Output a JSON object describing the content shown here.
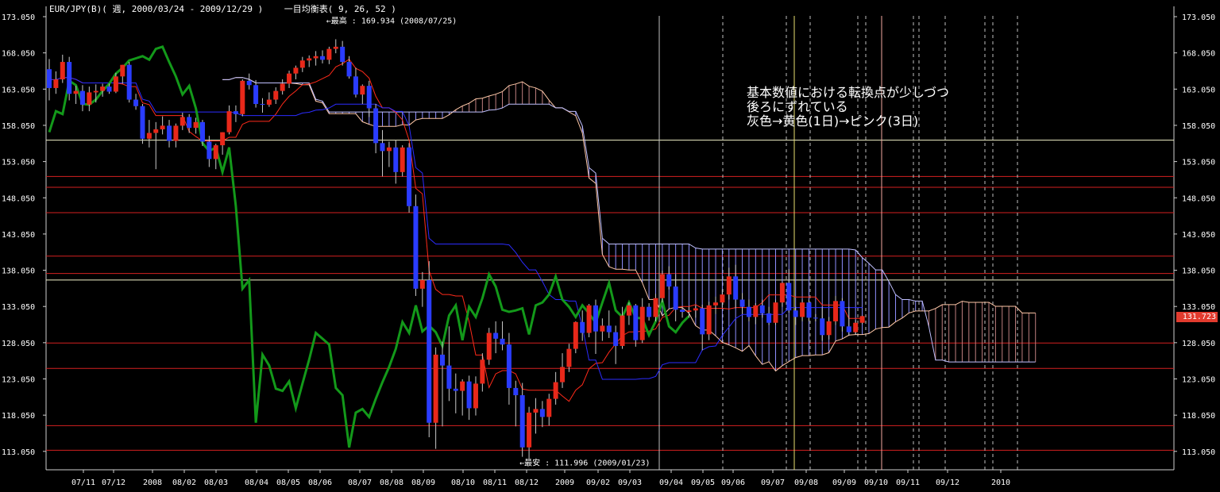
{
  "header": {
    "symbol": "EUR/JPY(B)( 週, 2000/03/24 - 2009/12/29 )",
    "indicator": "一目均衡表( 9, 26, 52 )"
  },
  "annotation": {
    "line1": "基本数値における転換点が少しづつ",
    "line2": "後ろにずれている",
    "line3": "灰色→黄色(1日)→ピンク(3日)"
  },
  "last_price": "131.723",
  "chart_data": {
    "type": "candlestick",
    "title": "",
    "ylim": [
      110.5,
      175.5
    ],
    "y_ticks": [
      "173.050",
      "168.050",
      "163.050",
      "158.050",
      "153.050",
      "148.050",
      "143.050",
      "138.050",
      "133.050",
      "128.050",
      "123.050",
      "118.050",
      "113.050"
    ],
    "x_ticks": [
      "07/11",
      "07/12",
      "2008",
      "08/02",
      "08/03",
      "08/04",
      "08/05",
      "08/06",
      "08/07",
      "08/08",
      "08/09",
      "08/10",
      "08/11",
      "08/12",
      "2009",
      "09/02",
      "09/03",
      "09/04",
      "09/05",
      "09/06",
      "09/07",
      "09/08",
      "09/09",
      "09/10",
      "09/11",
      "09/12",
      "2010"
    ],
    "highest_label": "←最高 : 169.934 (2008/07/25)",
    "lowest_label": "←最安 : 111.996 (2009/01/23)",
    "horizontal_lines": [
      156.0,
      151.0,
      149.5,
      146.0,
      140.0,
      137.6,
      136.7,
      128.0,
      124.5,
      116.6,
      113.2
    ],
    "candles": [
      [
        165.8,
        167.2,
        161.5,
        163.2
      ],
      [
        163.2,
        165.5,
        162.4,
        164.4
      ],
      [
        164.4,
        167.8,
        163.9,
        166.8
      ],
      [
        166.8,
        167.5,
        161.5,
        162.4
      ],
      [
        162.4,
        163.5,
        161.0,
        162.8
      ],
      [
        162.8,
        163.6,
        160.0,
        160.9
      ],
      [
        160.9,
        163.4,
        160.0,
        162.6
      ],
      [
        162.6,
        163.7,
        161.2,
        162.8
      ],
      [
        162.8,
        163.8,
        162.0,
        163.4
      ],
      [
        163.4,
        163.8,
        162.4,
        162.7
      ],
      [
        162.7,
        165.3,
        162.5,
        164.8
      ],
      [
        164.8,
        166.4,
        163.8,
        166.4
      ],
      [
        166.4,
        166.8,
        161.2,
        161.6
      ],
      [
        161.6,
        162.4,
        160.2,
        160.7
      ],
      [
        160.7,
        161.0,
        155.5,
        156.2
      ],
      [
        156.2,
        158.8,
        155.0,
        157.0
      ],
      [
        157.0,
        158.5,
        152.0,
        157.5
      ],
      [
        157.5,
        159.3,
        156.8,
        158.0
      ],
      [
        158.0,
        158.8,
        155.0,
        155.9
      ],
      [
        155.9,
        158.3,
        155.0,
        158.0
      ],
      [
        158.0,
        159.8,
        157.4,
        159.2
      ],
      [
        159.2,
        159.6,
        157.0,
        157.7
      ],
      [
        157.7,
        159.1,
        156.9,
        158.5
      ],
      [
        158.5,
        158.8,
        155.2,
        155.8
      ],
      [
        155.8,
        156.6,
        152.3,
        153.4
      ],
      [
        153.4,
        155.5,
        152.0,
        155.3
      ],
      [
        155.3,
        157.1,
        154.0,
        157.1
      ],
      [
        157.1,
        160.8,
        156.8,
        160.0
      ],
      [
        160.0,
        160.8,
        158.5,
        159.6
      ],
      [
        159.6,
        164.4,
        159.3,
        164.2
      ],
      [
        164.2,
        165.2,
        163.0,
        163.6
      ],
      [
        163.6,
        164.3,
        160.5,
        161.0
      ],
      [
        161.0,
        161.8,
        159.8,
        160.9
      ],
      [
        160.9,
        162.6,
        160.6,
        161.6
      ],
      [
        161.6,
        163.3,
        161.0,
        162.8
      ],
      [
        162.8,
        164.4,
        162.3,
        163.8
      ],
      [
        163.8,
        165.6,
        163.2,
        165.2
      ],
      [
        165.2,
        166.3,
        164.4,
        166.0
      ],
      [
        166.0,
        167.5,
        165.4,
        167.0
      ],
      [
        167.0,
        167.7,
        166.1,
        167.3
      ],
      [
        167.3,
        168.3,
        166.3,
        167.6
      ],
      [
        167.6,
        168.4,
        166.6,
        167.1
      ],
      [
        167.1,
        168.9,
        166.5,
        168.6
      ],
      [
        168.6,
        169.934,
        168.0,
        168.9
      ],
      [
        168.9,
        169.7,
        166.3,
        166.8
      ],
      [
        166.8,
        167.6,
        164.5,
        164.8
      ],
      [
        164.8,
        166.0,
        161.9,
        162.3
      ],
      [
        162.3,
        163.7,
        161.0,
        163.5
      ],
      [
        163.5,
        164.2,
        159.2,
        160.4
      ],
      [
        160.4,
        161.0,
        154.2,
        155.6
      ],
      [
        155.6,
        157.4,
        151.0,
        154.5
      ],
      [
        154.5,
        155.8,
        152.3,
        155.0
      ],
      [
        155.0,
        156.0,
        150.0,
        151.6
      ],
      [
        151.6,
        155.3,
        151.0,
        155.0
      ],
      [
        155.0,
        155.6,
        146.0,
        146.9
      ],
      [
        146.9,
        148.5,
        134.5,
        135.5
      ],
      [
        135.5,
        137.8,
        133.0,
        136.7
      ],
      [
        136.7,
        139.3,
        115.0,
        117.0
      ],
      [
        117.0,
        127.4,
        113.4,
        126.4
      ],
      [
        126.4,
        128.2,
        116.5,
        124.9
      ],
      [
        124.9,
        130.3,
        120.0,
        121.7
      ],
      [
        121.7,
        123.8,
        118.3,
        121.4
      ],
      [
        121.4,
        123.0,
        118.0,
        122.7
      ],
      [
        122.7,
        123.5,
        117.4,
        119.0
      ],
      [
        119.0,
        123.4,
        118.0,
        122.4
      ],
      [
        122.4,
        126.6,
        121.3,
        125.7
      ],
      [
        125.7,
        130.1,
        125.0,
        129.4
      ],
      [
        129.4,
        131.0,
        126.6,
        128.6
      ],
      [
        128.6,
        131.0,
        127.0,
        127.8
      ],
      [
        127.8,
        129.4,
        119.5,
        121.8
      ],
      [
        121.8,
        122.8,
        116.5,
        120.8
      ],
      [
        120.8,
        122.5,
        112.3,
        113.6
      ],
      [
        113.6,
        119.2,
        111.996,
        118.4
      ],
      [
        118.4,
        120.4,
        115.5,
        118.9
      ],
      [
        118.9,
        120.0,
        116.4,
        117.8
      ],
      [
        117.8,
        121.0,
        116.6,
        120.3
      ],
      [
        120.3,
        124.0,
        119.5,
        122.6
      ],
      [
        122.6,
        126.6,
        121.8,
        124.7
      ],
      [
        124.7,
        127.9,
        124.0,
        127.2
      ],
      [
        127.2,
        131.0,
        126.6,
        130.9
      ],
      [
        130.9,
        132.5,
        128.3,
        129.4
      ],
      [
        129.4,
        133.4,
        128.8,
        133.2
      ],
      [
        133.2,
        134.0,
        126.5,
        129.6
      ],
      [
        129.6,
        131.4,
        128.3,
        130.4
      ],
      [
        130.4,
        132.5,
        128.7,
        129.5
      ],
      [
        129.5,
        130.4,
        125.1,
        127.6
      ],
      [
        127.6,
        133.0,
        127.2,
        131.8
      ],
      [
        131.8,
        133.6,
        130.5,
        133.2
      ],
      [
        133.2,
        133.4,
        127.5,
        128.4
      ],
      [
        128.4,
        134.2,
        128.0,
        133.0
      ],
      [
        133.0,
        133.5,
        131.1,
        131.6
      ],
      [
        131.6,
        134.8,
        131.0,
        134.2
      ],
      [
        134.2,
        138.0,
        133.6,
        137.5
      ],
      [
        137.5,
        138.6,
        135.4,
        135.8
      ],
      [
        135.8,
        137.5,
        131.0,
        132.6
      ],
      [
        132.6,
        133.0,
        131.5,
        132.3
      ],
      [
        132.3,
        133.0,
        131.5,
        132.5
      ],
      [
        132.5,
        133.2,
        131.5,
        132.8
      ],
      [
        132.8,
        133.3,
        127.0,
        129.2
      ],
      [
        129.2,
        133.7,
        128.4,
        133.2
      ],
      [
        133.2,
        134.4,
        132.0,
        133.6
      ],
      [
        133.6,
        135.4,
        132.9,
        134.7
      ],
      [
        134.7,
        138.4,
        134.0,
        137.2
      ],
      [
        137.2,
        138.8,
        132.8,
        134.0
      ],
      [
        134.0,
        134.9,
        132.0,
        133.0
      ],
      [
        133.0,
        134.0,
        131.0,
        131.6
      ],
      [
        131.6,
        133.5,
        130.6,
        133.2
      ],
      [
        133.2,
        134.0,
        131.5,
        132.1
      ],
      [
        132.1,
        133.0,
        130.5,
        130.8
      ],
      [
        130.8,
        134.0,
        130.5,
        133.6
      ],
      [
        133.6,
        136.5,
        133.0,
        136.3
      ],
      [
        136.3,
        138.2,
        132.2,
        132.5
      ],
      [
        132.5,
        133.0,
        130.5,
        131.6
      ],
      [
        131.6,
        134.0,
        131.0,
        133.6
      ],
      [
        133.6,
        134.0,
        131.0,
        131.5
      ],
      [
        131.5,
        132.0,
        131.0,
        131.4
      ],
      [
        131.4,
        133.0,
        128.3,
        129.1
      ],
      [
        129.1,
        131.6,
        128.5,
        131.0
      ],
      [
        131.0,
        134.5,
        130.5,
        133.8
      ],
      [
        133.8,
        134.2,
        129.6,
        130.3
      ],
      [
        130.3,
        133.0,
        129.0,
        129.5
      ],
      [
        129.5,
        131.2,
        129.2,
        130.8
      ],
      [
        130.8,
        131.8,
        130.6,
        131.723
      ]
    ]
  },
  "colors": {
    "up": "#e8281a",
    "down": "#2a3cff",
    "tenkan": "#ff2a1a",
    "kijun": "#2c2cff",
    "senkou_a": "#ffc8a8",
    "senkou_b": "#c0c0ff",
    "chikou": "#13991a",
    "hline": "#d42020",
    "grid_gray": "#bfbfbf",
    "grid_yellow": "#e8e070",
    "grid_pink": "#f4a8a0"
  }
}
